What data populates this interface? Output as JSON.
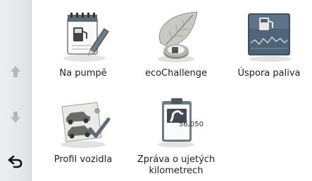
{
  "sidebar": {
    "scroll_up": "arrow-up-icon",
    "scroll_down": "arrow-down-icon",
    "back": "back-arrow-icon"
  },
  "menu": {
    "items": [
      {
        "label": "Na pumpě",
        "icon": "fuel-log-icon"
      },
      {
        "label": "ecoChallenge",
        "icon": "eco-leaf-icon"
      },
      {
        "label": "Úspora paliva",
        "icon": "fuel-economy-icon"
      },
      {
        "label": "Profil vozidla",
        "icon": "vehicle-profile-icon"
      },
      {
        "label": "Zpráva o ujetých kilometrech",
        "icon": "mileage-report-icon",
        "badge": "56,050"
      }
    ]
  },
  "colors": {
    "sidebar_bg": "#e4e7e9",
    "arrow_gray": "#b3b8bc",
    "text": "#1e1e1e"
  }
}
